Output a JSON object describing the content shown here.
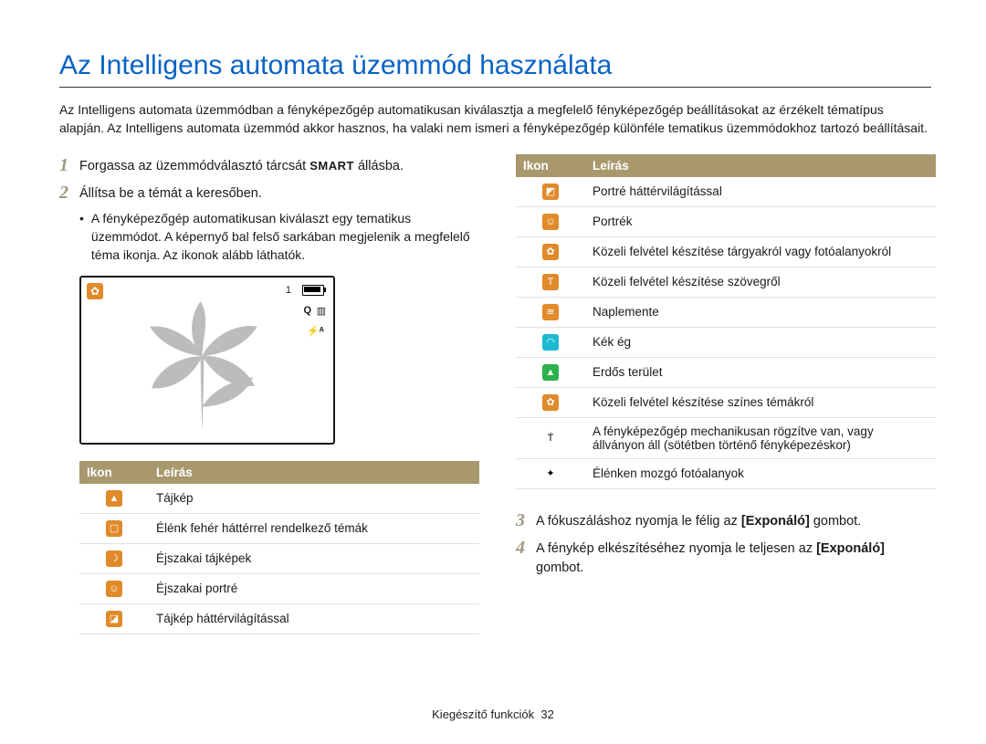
{
  "title": "Az Intelligens automata üzemmód használata",
  "intro": "Az Intelligens automata üzemmódban a fényképezőgép automatikusan kiválasztja a megfelelő fényképezőgép beállításokat az érzékelt tématípus alapján. Az Intelligens automata üzemmód akkor hasznos, ha valaki nem ismeri a fényképezőgép különféle tematikus üzemmódokhoz tartozó beállításait.",
  "step1_pre": "Forgassa az üzemmódválasztó tárcsát ",
  "step1_smart": "SMART",
  "step1_post": " állásba.",
  "step2": "Állítsa be a témát a keresőben.",
  "step2_bullet": "A fényképezőgép automatikusan kiválaszt egy tematikus üzemmódot. A képernyő bal felső sarkában megjelenik a megfelelő téma ikonja. Az ikonok alább láthatók.",
  "lcd": {
    "ind_1": "1",
    "ind_q": "Q",
    "ind_sd": "▥",
    "ind_flash": "⚡ᴬ"
  },
  "table_header_icon": "Ikon",
  "table_header_desc": "Leírás",
  "table_left": [
    {
      "bg": "c-orange",
      "sym": "▲",
      "desc": "Tájkép"
    },
    {
      "bg": "c-orange",
      "sym": "▢",
      "desc": "Élénk fehér háttérrel rendelkező témák"
    },
    {
      "bg": "c-orange",
      "sym": "☽",
      "desc": "Éjszakai tájképek"
    },
    {
      "bg": "c-orange",
      "sym": "☺",
      "desc": "Éjszakai portré"
    },
    {
      "bg": "c-orange",
      "sym": "◪",
      "desc": "Tájkép háttérvilágítással"
    }
  ],
  "table_right": [
    {
      "bg": "c-orange",
      "sym": "◩",
      "desc": "Portré háttérvilágítással"
    },
    {
      "bg": "c-orange",
      "sym": "☺",
      "desc": "Portrék"
    },
    {
      "bg": "c-orange",
      "sym": "✿",
      "desc": "Közeli felvétel készítése tárgyakról vagy fotóalanyokról"
    },
    {
      "bg": "c-orange",
      "sym": "T",
      "desc": "Közeli felvétel készítése szövegről"
    },
    {
      "bg": "c-orange",
      "sym": "≋",
      "desc": "Naplemente"
    },
    {
      "bg": "c-teal",
      "sym": "◠",
      "desc": "Kék ég"
    },
    {
      "bg": "c-green",
      "sym": "▲",
      "desc": "Erdős terület"
    },
    {
      "bg": "c-orange",
      "sym": "✿",
      "desc": "Közeli felvétel készítése színes témákról"
    },
    {
      "bg": "c-white",
      "sym": "Ṫ",
      "desc": "A fényképezőgép mechanikusan rögzítve van, vagy állványon áll (sötétben történő fényképezéskor)"
    },
    {
      "bg": "c-white",
      "sym": "✦",
      "desc": "Élénken mozgó fotóalanyok"
    }
  ],
  "step3_pre": "A fókuszáláshoz nyomja le félig az ",
  "step3_bold": "[Exponáló]",
  "step3_post": " gombot.",
  "step4_pre": "A fénykép elkészítéséhez nyomja le teljesen az ",
  "step4_bold": "[Exponáló]",
  "step4_post": " gombot.",
  "footer": "Kiegészítő funkciók",
  "footer_page": "32"
}
